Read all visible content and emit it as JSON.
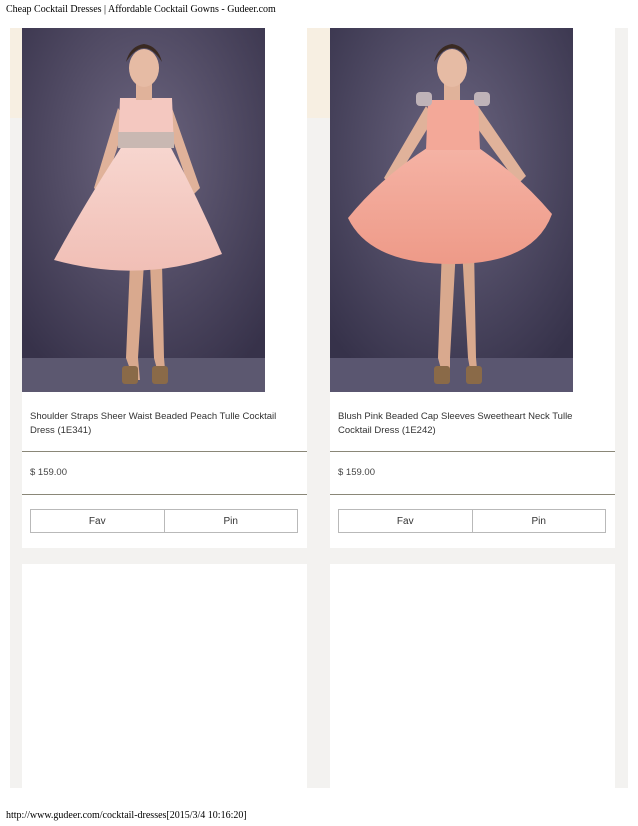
{
  "print_header": {
    "title": "Cheap Cocktail Dresses | Affordable Cocktail Gowns - Gudeer.com"
  },
  "print_footer": {
    "url_timestamp": "http://www.gudeer.com/cocktail-dresses[2015/3/4 10:16:20]"
  },
  "products": [
    {
      "name": "Shoulder Straps Sheer Waist Beaded Peach Tulle Cocktail Dress (1E341)",
      "price": "$ 159.00",
      "fav_label": "Fav",
      "pin_label": "Pin",
      "image_alt": "Peach tulle cocktail dress"
    },
    {
      "name": "Blush Pink Beaded Cap Sleeves Sweetheart Neck Tulle Cocktail Dress (1E242)",
      "price": "$ 159.00",
      "fav_label": "Fav",
      "pin_label": "Pin",
      "image_alt": "Blush pink tulle cocktail dress"
    }
  ],
  "colors": {
    "photo_background": "#4a4560",
    "dress_peach": "#f4c8c0",
    "dress_blush": "#f3a898",
    "divider": "#8a8778"
  }
}
